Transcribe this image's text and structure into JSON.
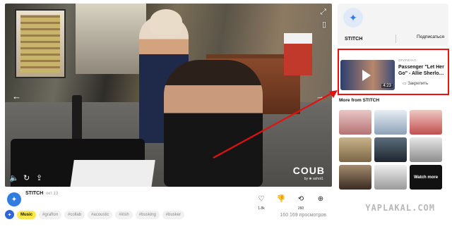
{
  "video": {
    "watermark": "COUB",
    "watermark_sub": "by ❀ ashot1",
    "icons": [
      "volume-icon",
      "loop-icon",
      "share-icon",
      "fullscreen-icon",
      "bookmark-icon"
    ]
  },
  "meta": {
    "channel": "STITCH",
    "date": "окт 13",
    "actions": [
      {
        "name": "like",
        "icon": "♡",
        "count": "1.8k"
      },
      {
        "name": "dislike",
        "icon": "👎",
        "count": ""
      },
      {
        "name": "recoub",
        "icon": "⟲",
        "count": "260"
      },
      {
        "name": "add",
        "icon": "⊕",
        "count": ""
      }
    ],
    "tags": [
      "Music",
      "#grafton",
      "#collab",
      "#acoustic",
      "#irish",
      "#busking",
      "#busker"
    ],
    "views": "160 169 просмотров"
  },
  "sidebar": {
    "channel_name": "STITCH",
    "subscribe_label": "Подписаться",
    "recommended": {
      "label": "ОРИГИНАЛ",
      "title": "Passenger \"Let Her Go\" - Allie Sherlo…",
      "duration": "4:23",
      "save_label": "Закрепить"
    },
    "more_from": "More from STITCH",
    "watch_more": "Watch more"
  },
  "site_watermark": "YAPLAKAL.COM",
  "colors": {
    "accent": "#2f65d9",
    "highlight": "#e11111",
    "tag_music": "#ffe64d"
  }
}
